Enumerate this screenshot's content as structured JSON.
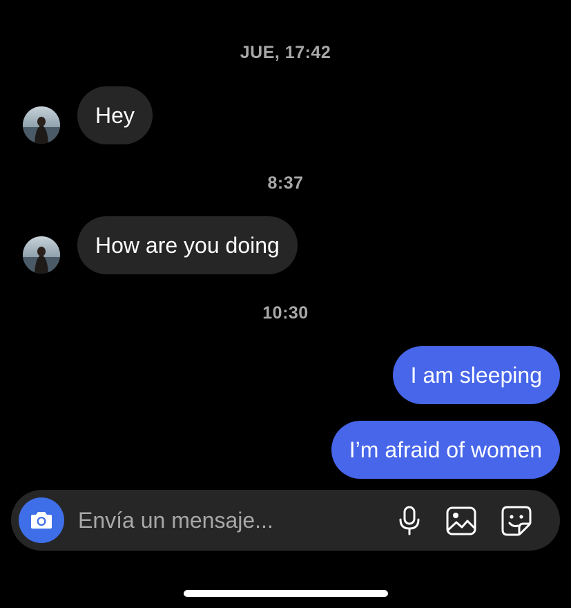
{
  "thread": {
    "timestamps": [
      "JUE, 17:42",
      "8:37",
      "10:30"
    ],
    "messages": [
      {
        "from": "them",
        "text": "Hey"
      },
      {
        "from": "them",
        "text": "How are you doing"
      },
      {
        "from": "me",
        "text": "I am sleeping"
      },
      {
        "from": "me",
        "text": "I’m afraid of women"
      }
    ]
  },
  "composer": {
    "placeholder": "Envía un mensaje...",
    "icons": [
      "camera-icon",
      "microphone-icon",
      "gallery-icon",
      "sticker-icon"
    ]
  },
  "colors": {
    "background": "#000000",
    "incoming_bubble": "#262626",
    "outgoing_bubble": "#4766ea",
    "camera_button": "#3f6fe8",
    "timestamp_text": "#a8a8a8"
  }
}
